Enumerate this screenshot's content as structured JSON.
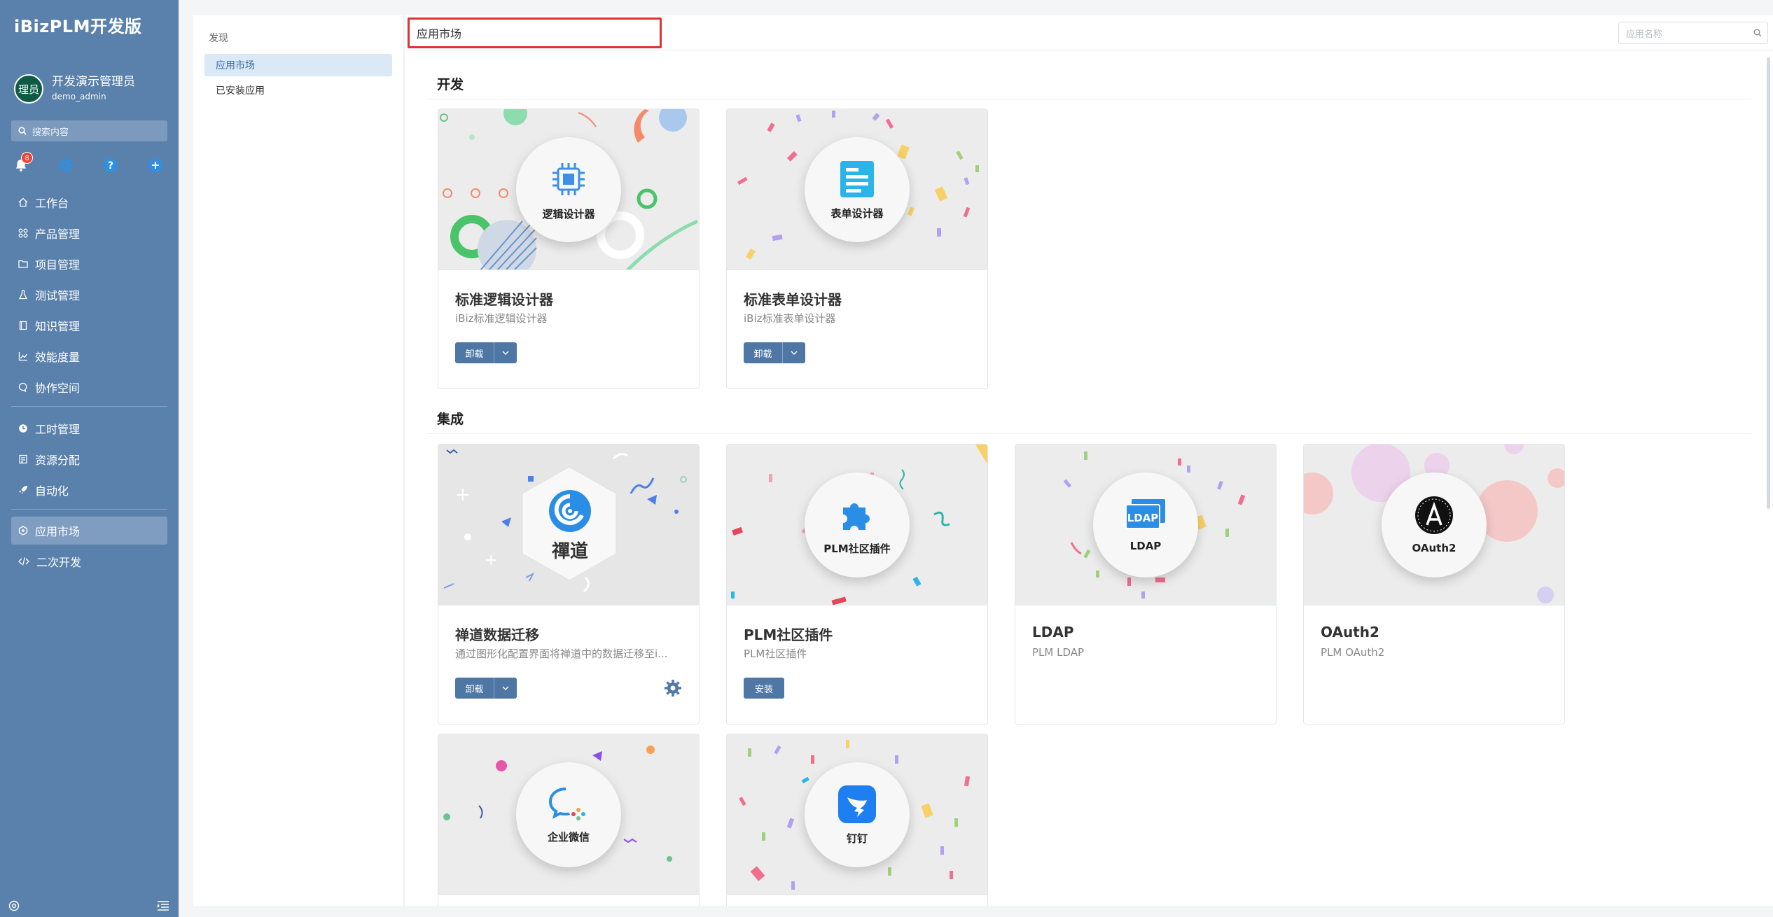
{
  "sidebar": {
    "brand": "iBizPLM开发版",
    "user": {
      "avatar_text": "理员",
      "name": "开发演示管理员",
      "account": "demo_admin"
    },
    "search_placeholder": "搜索内容",
    "notification_count": "8",
    "quick_icons": [
      "bell-icon",
      "gear-icon",
      "help-icon",
      "add-icon"
    ],
    "nav_group1": [
      {
        "label": "工作台",
        "icon": "home-icon"
      },
      {
        "label": "产品管理",
        "icon": "product-icon"
      },
      {
        "label": "项目管理",
        "icon": "folder-icon"
      },
      {
        "label": "测试管理",
        "icon": "flask-icon"
      },
      {
        "label": "知识管理",
        "icon": "book-icon"
      },
      {
        "label": "效能度量",
        "icon": "chart-icon"
      },
      {
        "label": "协作空间",
        "icon": "chat-icon"
      }
    ],
    "nav_group2": [
      {
        "label": "工时管理",
        "icon": "clock-icon"
      },
      {
        "label": "资源分配",
        "icon": "resource-icon"
      },
      {
        "label": "自动化",
        "icon": "rocket-icon"
      }
    ],
    "nav_group3": [
      {
        "label": "应用市场",
        "icon": "market-icon",
        "active": true
      },
      {
        "label": "二次开发",
        "icon": "code-icon"
      }
    ]
  },
  "submenu": {
    "group_label": "发现",
    "items": [
      {
        "label": "应用市场",
        "active": true
      },
      {
        "label": "已安装应用"
      }
    ]
  },
  "main": {
    "tab_title": "应用市场",
    "search_placeholder": "应用名称",
    "sections": [
      {
        "title": "开发",
        "cards": [
          {
            "circle_label": "逻辑设计器",
            "title": "标准逻辑设计器",
            "desc": "iBiz标准逻辑设计器",
            "button": "卸载",
            "has_dropdown": true
          },
          {
            "circle_label": "表单设计器",
            "title": "标准表单设计器",
            "desc": "iBiz标准表单设计器",
            "button": "卸载",
            "has_dropdown": true
          }
        ]
      },
      {
        "title": "集成",
        "cards": [
          {
            "circle_label": "禪道",
            "title": "禅道数据迁移",
            "desc": "通过图形化配置界面将禅道中的数据迁移至i...",
            "button": "卸载",
            "has_dropdown": true,
            "has_settings": true
          },
          {
            "circle_label": "PLM社区插件",
            "title": "PLM社区插件",
            "desc": "PLM社区插件",
            "button": "安装"
          },
          {
            "circle_label": "LDAP",
            "title": "LDAP",
            "desc": "PLM LDAP"
          },
          {
            "circle_label": "OAuth2",
            "title": "OAuth2",
            "desc": "PLM OAuth2"
          },
          {
            "circle_label": "企业微信"
          },
          {
            "circle_label": "钉钉"
          }
        ]
      }
    ],
    "ldap_icon_text": "LDAP"
  },
  "colors": {
    "sidebar_bg": "#5a81ab",
    "button_primary": "#4f77a6",
    "highlight_border": "#e03131",
    "submenu_active_bg": "#dbe8f6"
  }
}
